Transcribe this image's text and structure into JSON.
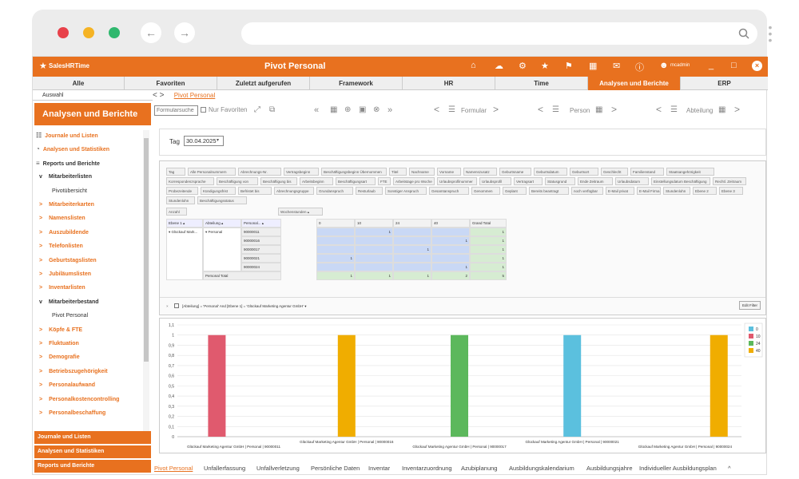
{
  "app": {
    "brand": "SalesHRTime",
    "title": "Pivot Personal",
    "user": "mcadmin"
  },
  "menu": [
    "Alle",
    "Favoriten",
    "Zuletzt aufgerufen",
    "Framework",
    "HR",
    "Time",
    "Analysen und Berichte",
    "ERP"
  ],
  "auswahl": "Auswahl",
  "breadcrumb": {
    "nav": "< >",
    "current": "Pivot Personal"
  },
  "sidebar": {
    "heading": "Analysen und Berichte",
    "items": [
      {
        "label": "Journale und Listen",
        "style": "orange",
        "icon": "list-icon"
      },
      {
        "label": "Analysen und Statistiken",
        "style": "orange",
        "icon": "chart-icon"
      },
      {
        "label": "Reports und Berichte",
        "style": "black",
        "icon": "report-icon"
      },
      {
        "label": "Mitarbeiterlisten",
        "style": "black",
        "prefix": "v"
      },
      {
        "label": "Pivotübersicht",
        "style": "plain"
      },
      {
        "label": "Mitarbeiterkarten",
        "style": "orange",
        "prefix": ">"
      },
      {
        "label": "Namenslisten",
        "style": "orange",
        "prefix": ">"
      },
      {
        "label": "Auszubildende",
        "style": "orange",
        "prefix": ">"
      },
      {
        "label": "Telefonlisten",
        "style": "orange",
        "prefix": ">"
      },
      {
        "label": "Geburtstagslisten",
        "style": "orange",
        "prefix": ">"
      },
      {
        "label": "Jubiläumslisten",
        "style": "orange",
        "prefix": ">"
      },
      {
        "label": "Inventarlisten",
        "style": "orange",
        "prefix": ">"
      },
      {
        "label": "Mitarbeiterbestand",
        "style": "black",
        "prefix": "v"
      },
      {
        "label": "Pivot Personal",
        "style": "plain"
      },
      {
        "label": "Köpfe & FTE",
        "style": "orange",
        "prefix": ">"
      },
      {
        "label": "Fluktuation",
        "style": "orange",
        "prefix": ">"
      },
      {
        "label": "Demografie",
        "style": "orange",
        "prefix": ">"
      },
      {
        "label": "Betriebszugehörigkeit",
        "style": "orange",
        "prefix": ">"
      },
      {
        "label": "Personalaufwand",
        "style": "orange",
        "prefix": ">"
      },
      {
        "label": "Personalkostencontrolling",
        "style": "orange",
        "prefix": ">"
      },
      {
        "label": "Personalbeschaffung",
        "style": "orange",
        "prefix": ">"
      }
    ],
    "footer": [
      "Journale und Listen",
      "Analysen und Statistiken",
      "Reports und Berichte"
    ]
  },
  "toolbar": {
    "search_placeholder": "Formularsuche",
    "only_favorites": "Nur Favoriten",
    "formular": "Formular",
    "person": "Person",
    "abteilung": "Abteilung"
  },
  "filter": {
    "label": "Tag",
    "value": "30.04.2025"
  },
  "pivot": {
    "fields": [
      "Tag",
      "Alle Personalnummern",
      "Abrechnungs-Nr.",
      "Vertragsbeginn",
      "Beschäftigungsbeginn Übernommen",
      "Titel",
      "Nachname",
      "Vorname",
      "Namenszusatz",
      "Geburtsname",
      "Geburtsdatum",
      "Geburtsort",
      "Geschlecht",
      "Familienstand",
      "Staatsangehörigkeit",
      "Korrespondenzsprache",
      "Beschäftigung von",
      "Beschäftigung bis",
      "Arbeitsbeginn",
      "Beschäftigungsart",
      "FTE",
      "Arbeitstage pro Woche",
      "Urlaubsprofilnummer",
      "Urlaubsprofil",
      "Vertragsart",
      "Statusgrund",
      "Ende Zeitraum",
      "Urlaubsdatum",
      "Einstellungsdatum Beschäftigung",
      "Rechtl. Zeitraum",
      "Probezeitende",
      "Kündigungsfrist",
      "Befristet bis",
      "Abrechnungsgruppe",
      "Grundanspruch",
      "Resturlaub",
      "Sonstiger Anspruch",
      "Gesamtanspruch",
      "Genommen",
      "Geplant",
      "Bereits beantragt",
      "noch verfügbar",
      "E-Mail privat",
      "E-Mail Firma",
      "Stundenlohn",
      "Ebene 2",
      "Ebene 3",
      "Stundenlohn",
      "Beschäftigungsstatus"
    ],
    "data_field": "Anzahl",
    "column_field": "Wochenstunden",
    "row_headers": [
      "Ebene 1",
      "Abteilung",
      "Personal..."
    ],
    "columns": [
      "0",
      "10",
      "24",
      "40",
      "Grand Total"
    ],
    "row_group": "Glückauf Mark...",
    "abteilung": "Personal",
    "rows": [
      {
        "id": "90000011",
        "values": [
          "",
          "1",
          "",
          "",
          ""
        ],
        "total": "1"
      },
      {
        "id": "90000016",
        "values": [
          "",
          "",
          "",
          "1",
          ""
        ],
        "total": "1"
      },
      {
        "id": "90000017",
        "values": [
          "",
          "",
          "1",
          "",
          ""
        ],
        "total": "1"
      },
      {
        "id": "90000021",
        "values": [
          "1",
          "",
          "",
          "",
          ""
        ],
        "total": "1"
      },
      {
        "id": "90000024",
        "values": [
          "",
          "",
          "",
          "1",
          ""
        ],
        "total": "1"
      }
    ],
    "total_label": "Personal Total",
    "totals": [
      "1",
      "1",
      "1",
      "2",
      "5"
    ],
    "filter_text": "[Abteilung] = 'Personal' And [Ebene 1] = 'Glückauf Marketing Agentur GmbH'",
    "edit_filter": "Edit Filter"
  },
  "chart_data": {
    "type": "bar",
    "categories": [
      "Glückauf Marketing Agentur GmbH | Personal | 90000011",
      "Glückauf Marketing Agentur GmbH | Personal | 90000016",
      "Glückauf Marketing Agentur GmbH | Personal | 90000017",
      "Glückauf Marketing Agentur GmbH | Personal | 90000021",
      "Glückauf Marketing Agentur GmbH | Personal | 90000024"
    ],
    "series": [
      {
        "name": "0",
        "color": "#5bc0de",
        "values": [
          0,
          0,
          0,
          1,
          0
        ]
      },
      {
        "name": "10",
        "color": "#e05a6e",
        "values": [
          1,
          0,
          0,
          0,
          0
        ]
      },
      {
        "name": "24",
        "color": "#5cb85c",
        "values": [
          0,
          0,
          1,
          0,
          0
        ]
      },
      {
        "name": "40",
        "color": "#f0ad00",
        "values": [
          0,
          1,
          0,
          0,
          1
        ]
      }
    ],
    "yticks": [
      "0",
      "0,1",
      "0,2",
      "0,3",
      "0,4",
      "0,5",
      "0,6",
      "0,7",
      "0,8",
      "0,9",
      "1",
      "1,1"
    ],
    "ylim": [
      0,
      1.1
    ]
  },
  "tabs": [
    "Pivot Personal",
    "Unfallerfassung",
    "Unfallverletzung",
    "Persönliche Daten",
    "Inventar",
    "Inventarzuordnung",
    "Azubiplanung",
    "Ausbildungskalendarium",
    "Ausbildungsjahre",
    "Individueller Ausbildungsplan",
    "^"
  ]
}
